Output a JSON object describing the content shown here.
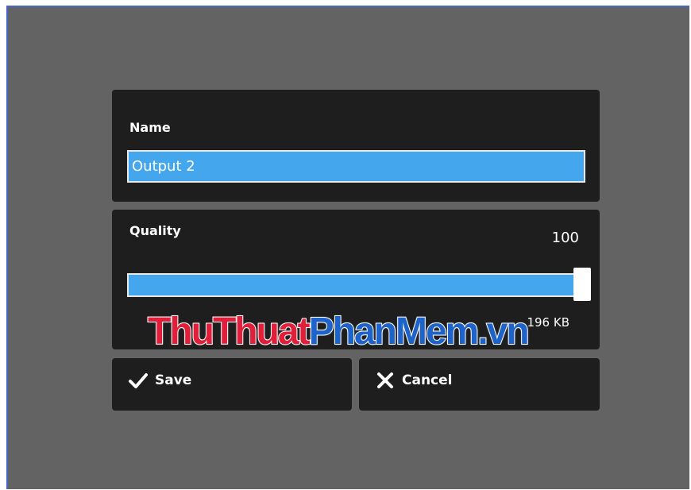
{
  "dialog": {
    "name_label": "Name",
    "name_value": "Output 2",
    "quality_label": "Quality",
    "quality_value": "100",
    "quality_level": 100,
    "size_text": "196 KB",
    "save_label": "Save",
    "cancel_label": "Cancel",
    "save_icon": "checkmark-icon",
    "cancel_icon": "close-icon"
  },
  "watermark": {
    "part1": "ThuThuat",
    "part2": "PhanMem.vn"
  },
  "colors": {
    "backdrop": "#636363",
    "panel": "#1e1e1e",
    "accent": "#44a7ee",
    "watermark_red": "#e21f3a",
    "watermark_blue": "#1d63c9"
  }
}
